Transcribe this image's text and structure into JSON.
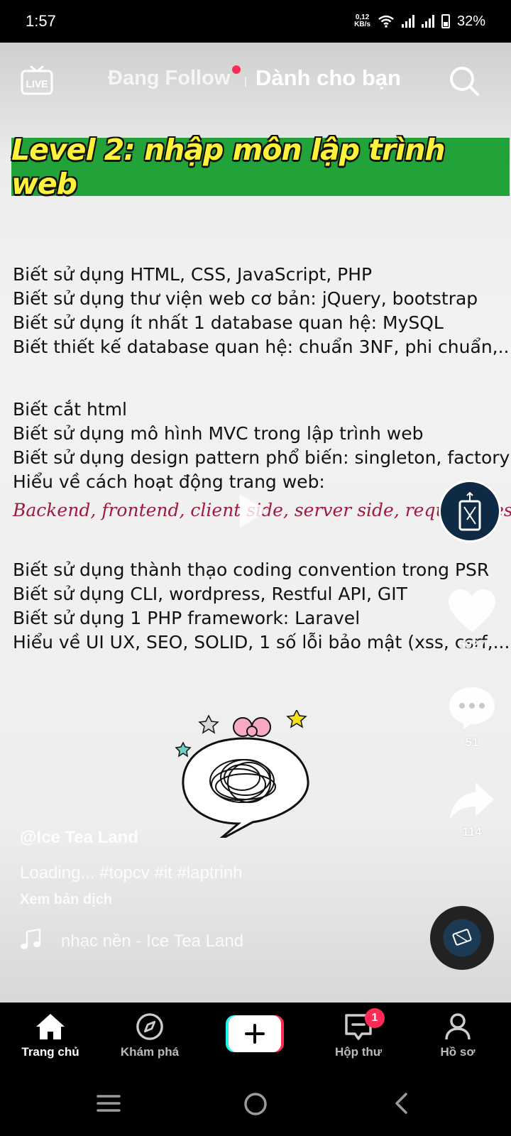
{
  "status_bar": {
    "time": "1:57",
    "net_speed_value": "0,12",
    "net_speed_unit": "KB/s",
    "battery": "32%"
  },
  "top_nav": {
    "following_label": "Đang Follow",
    "for_you_label": "Dành cho bạn",
    "live_label": "LIVE"
  },
  "video": {
    "banner_title": "Level 2: nhập môn lập trình web",
    "lines_group1": [
      "Biết sử dụng HTML, CSS, JavaScript, PHP",
      "Biết sử dụng thư viện web cơ bản: jQuery, bootstrap",
      "Biết sử dụng ít nhất 1 database quan hệ: MySQL",
      "Biết thiết kế database quan hệ: chuẩn 3NF, phi chuẩn,..."
    ],
    "lines_group2": [
      "Biết cắt html",
      "Biết sử dụng mô hình MVC trong lập trình web",
      "Biết sử dụng design pattern phổ biến: singleton, factory",
      "Hiểu về cách hoạt động trang web:"
    ],
    "script_line": "Backend, frontend, client side, server side, request, respon",
    "lines_group3": [
      "Biết sử dụng thành thạo coding convention trong PSR",
      "Biết sử dụng CLI, wordpress, Restful API, GIT",
      "Biết sử dụng 1 PHP framework: Laravel",
      "Hiểu về UI UX, SEO, SOLID, 1 số lỗi bảo mật (xss, csrf,...)"
    ]
  },
  "actions": {
    "likes": "5927",
    "comments": "51",
    "shares": "114"
  },
  "caption": {
    "author": "@Ice Tea Land",
    "text": "Loading... #topcv #it #laptrinh",
    "see_translation": "Xem bản dịch",
    "music": "nhạc nền - Ice Tea Land"
  },
  "tab_bar": {
    "home": "Trang chủ",
    "discover": "Khám phá",
    "inbox": "Hộp thư",
    "inbox_badge": "1",
    "profile": "Hồ sơ"
  },
  "colors": {
    "accent": "#fe2c55",
    "banner_green": "#22a33a",
    "banner_text": "#fff23a",
    "script_text": "#9e1b3c"
  }
}
